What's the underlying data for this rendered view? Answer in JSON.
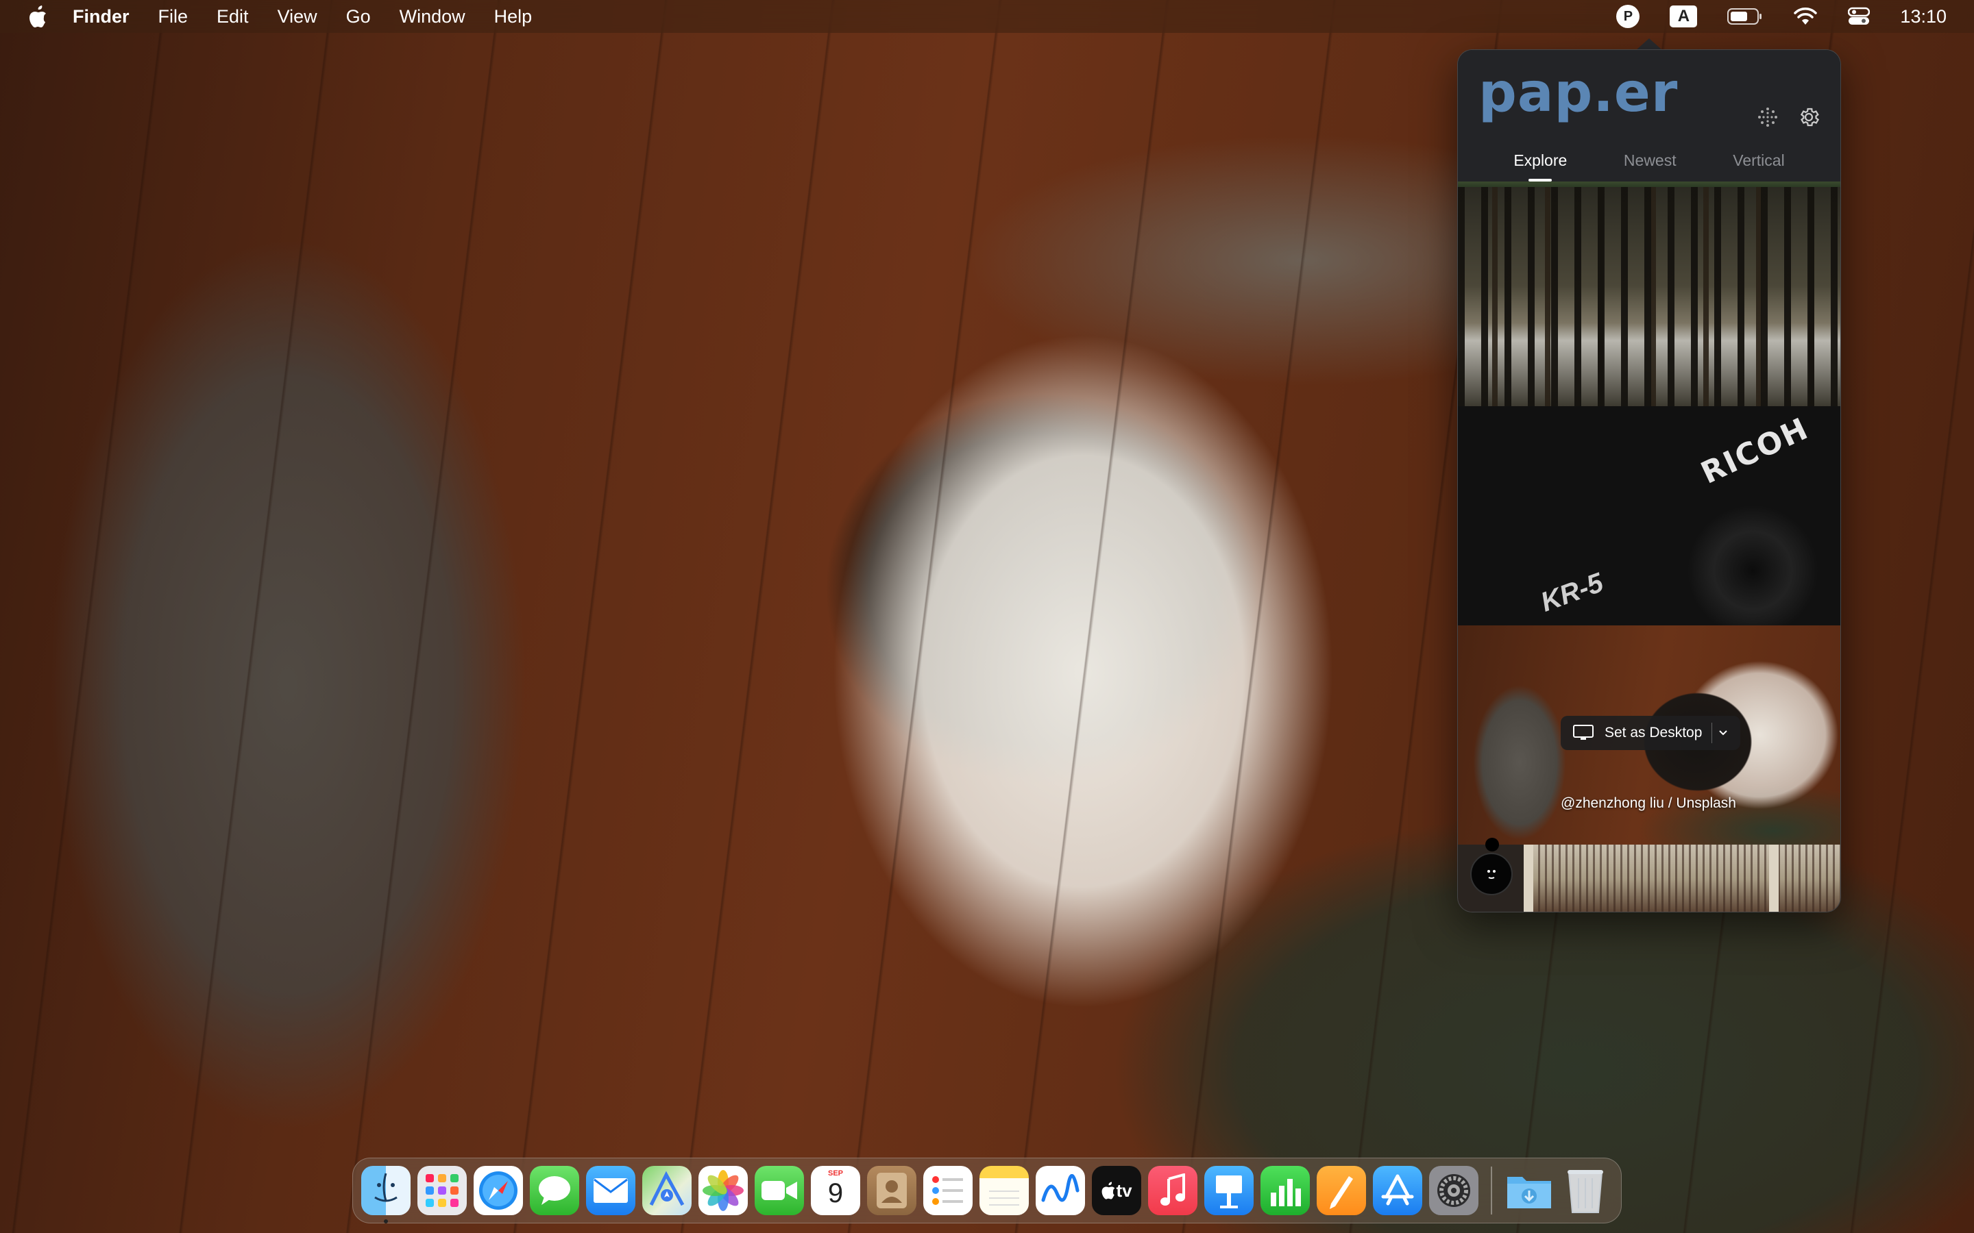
{
  "menubar": {
    "app_name": "Finder",
    "menus": [
      "File",
      "Edit",
      "View",
      "Go",
      "Window",
      "Help"
    ],
    "status_icons": {
      "paper_badge": "P",
      "input_source": "A",
      "battery": "battery-icon",
      "wifi": "wifi-icon",
      "control_center": "control-center-icon"
    },
    "clock": "13:10"
  },
  "paper_popover": {
    "logo": "pap.er",
    "tabs": [
      "Explore",
      "Newest",
      "Vertical"
    ],
    "active_tab": "Explore",
    "accent": "#5b86b4",
    "thumbnails": [
      {
        "subject": "forest"
      },
      {
        "subject": "camera",
        "text1": "RICOH",
        "text2": "KR-5"
      },
      {
        "subject": "current-wallpaper",
        "set_desktop_label": "Set as Desktop",
        "credit": "@zhenzhong liu / Unsplash"
      },
      {
        "subject": "bookshelf"
      }
    ]
  },
  "dock": {
    "apps": [
      "Finder",
      "Launchpad",
      "Safari",
      "Messages",
      "Mail",
      "Maps",
      "Photos",
      "FaceTime",
      "Calendar",
      "Contacts",
      "Reminders",
      "Notes",
      "Freeform",
      "TV",
      "Music",
      "Keynote",
      "Numbers",
      "Pages",
      "App Store",
      "System Settings"
    ],
    "calendar": {
      "month": "SEP",
      "day": "9"
    },
    "tv_label": "tv",
    "trailing": [
      "Downloads",
      "Trash"
    ]
  }
}
